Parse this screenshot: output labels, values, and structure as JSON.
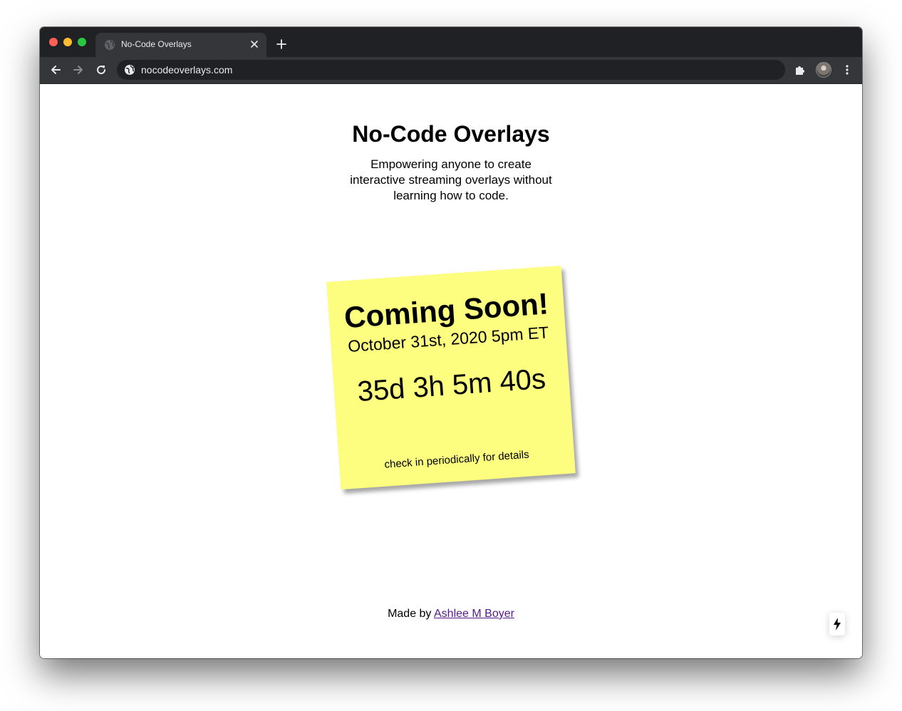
{
  "browser": {
    "tab": {
      "title": "No-Code Overlays",
      "favicon": "globe-icon",
      "close_icon": "close-icon"
    },
    "new_tab_icon": "plus-icon",
    "toolbar": {
      "back_icon": "arrow-left-icon",
      "forward_icon": "arrow-right-icon",
      "reload_icon": "reload-icon",
      "site_info_icon": "globe-icon",
      "url": "nocodeoverlays.com",
      "extensions_icon": "puzzle-icon",
      "menu_icon": "vertical-dots-icon"
    },
    "colors": {
      "titlebar": "#202124",
      "toolbar": "#35363a",
      "omnibox": "#202124",
      "text": "#e8eaed"
    }
  },
  "page": {
    "title": "No-Code Overlays",
    "subtitle": "Empowering anyone to create interactive streaming overlays without learning how to code.",
    "sticky_note": {
      "heading": "Coming Soon!",
      "date": "October 31st, 2020 5pm ET",
      "countdown": "35d 3h 5m 40s",
      "note": "check in periodically for details",
      "color": "#fdfd80"
    },
    "footer": {
      "prefix": "Made by",
      "author_link": "Ashlee M Boyer",
      "link_color": "#551a8b"
    },
    "badge_icon": "lightning-bolt-icon"
  }
}
